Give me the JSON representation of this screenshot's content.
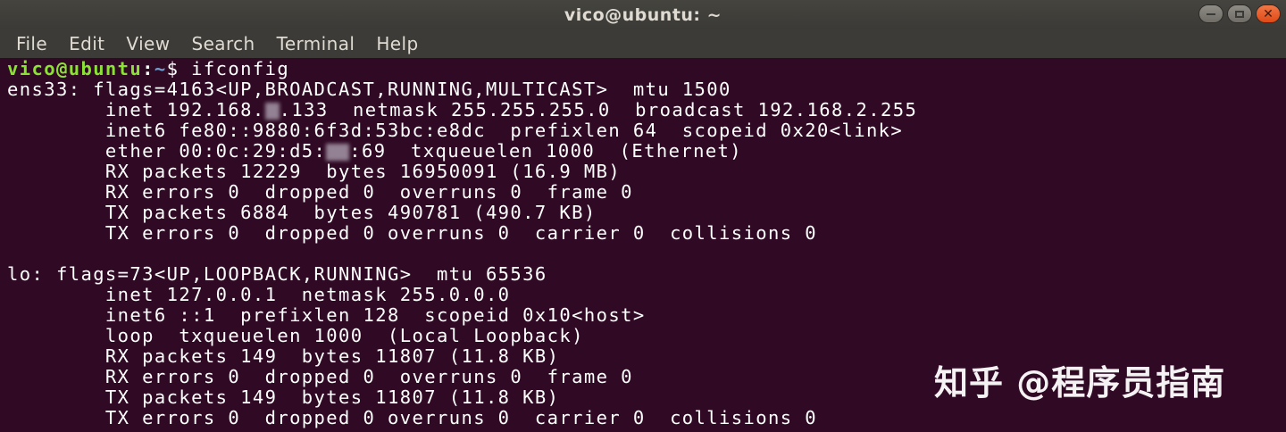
{
  "window": {
    "title": "vico@ubuntu: ~"
  },
  "menu": [
    "File",
    "Edit",
    "View",
    "Search",
    "Terminal",
    "Help"
  ],
  "prompt": {
    "user_host": "vico@ubuntu",
    "sep": ":",
    "path": "~",
    "dollar": "$ ",
    "command": "ifconfig"
  },
  "output": {
    "ens33_header": "ens33: flags=4163<UP,BROADCAST,RUNNING,MULTICAST>  mtu 1500",
    "ens33_inet_a": "        inet 192.168.",
    "ens33_inet_b": ".133  netmask 255.255.255.0  broadcast 192.168.2.255",
    "ens33_inet6": "        inet6 fe80::9880:6f3d:53bc:e8dc  prefixlen 64  scopeid 0x20<link>",
    "ens33_ether_a": "        ether 00:0c:29:d5:",
    "ens33_ether_b": ":69  txqueuelen 1000  (Ethernet)",
    "ens33_rx_packets": "        RX packets 12229  bytes 16950091 (16.9 MB)",
    "ens33_rx_errors": "        RX errors 0  dropped 0  overruns 0  frame 0",
    "ens33_tx_packets": "        TX packets 6884  bytes 490781 (490.7 KB)",
    "ens33_tx_errors": "        TX errors 0  dropped 0 overruns 0  carrier 0  collisions 0",
    "lo_header": "lo: flags=73<UP,LOOPBACK,RUNNING>  mtu 65536",
    "lo_inet": "        inet 127.0.0.1  netmask 255.0.0.0",
    "lo_inet6": "        inet6 ::1  prefixlen 128  scopeid 0x10<host>",
    "lo_loop": "        loop  txqueuelen 1000  (Local Loopback)",
    "lo_rx_packets": "        RX packets 149  bytes 11807 (11.8 KB)",
    "lo_rx_errors": "        RX errors 0  dropped 0  overruns 0  frame 0",
    "lo_tx_packets": "        TX packets 149  bytes 11807 (11.8 KB)",
    "lo_tx_errors": "        TX errors 0  dropped 0 overruns 0  carrier 0  collisions 0"
  },
  "watermark": "知乎 @程序员指南",
  "colors": {
    "background": "#300a24",
    "prompt_user": "#8ae234",
    "prompt_path": "#729fcf",
    "titlebar": "#3c3b37",
    "close_button": "#e95420"
  },
  "icons": [
    "minimize-icon",
    "maximize-icon",
    "close-icon"
  ]
}
